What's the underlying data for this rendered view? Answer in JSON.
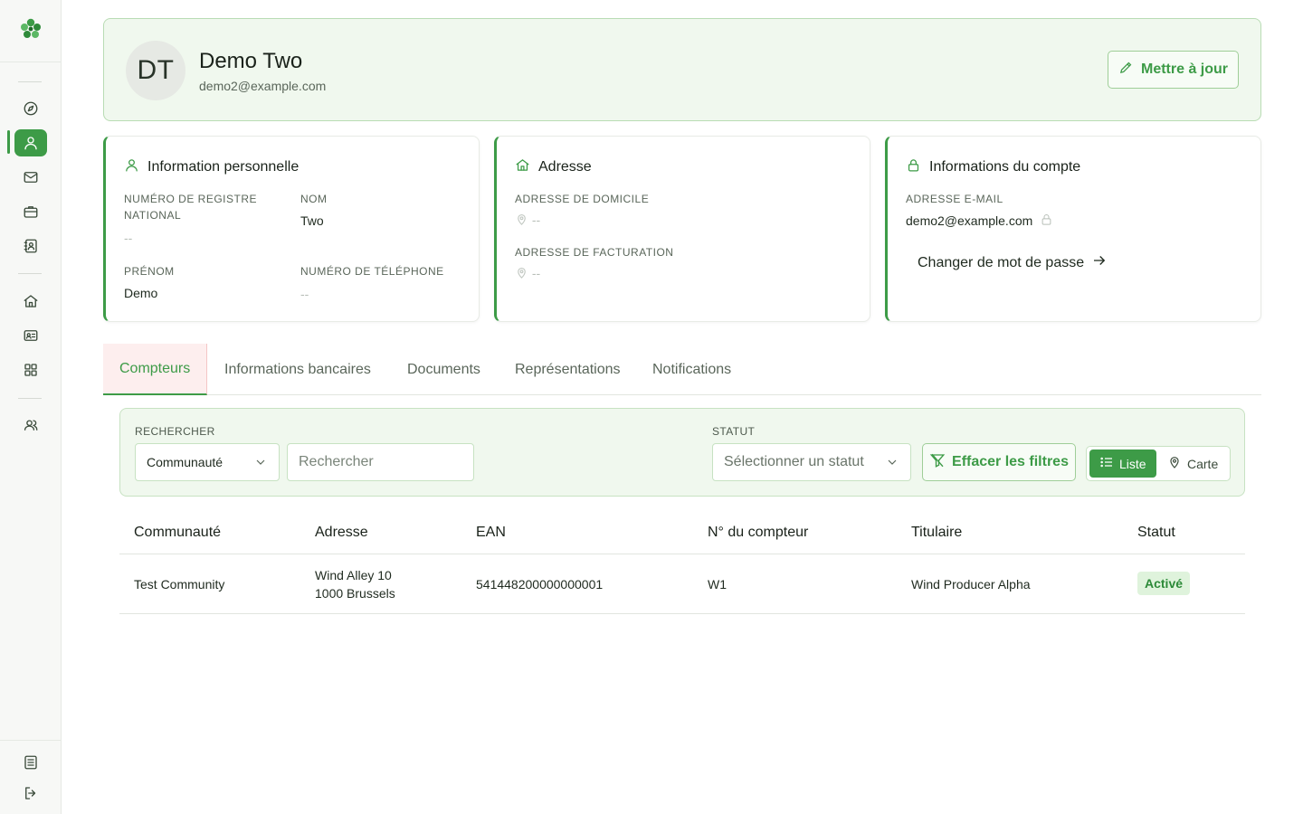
{
  "profile": {
    "initials": "DT",
    "name": "Demo Two",
    "email": "demo2@example.com",
    "update_label": "Mettre à jour"
  },
  "personal": {
    "title": "Information personnelle",
    "registry_label": "Numéro de registre national",
    "registry_value": "--",
    "lastname_label": "Nom",
    "lastname_value": "Two",
    "firstname_label": "Prénom",
    "firstname_value": "Demo",
    "phone_label": "Numéro de téléphone",
    "phone_value": "--"
  },
  "address": {
    "title": "Adresse",
    "home_label": "Adresse de domicile",
    "home_value": "--",
    "billing_label": "Adresse de facturation",
    "billing_value": "--"
  },
  "account": {
    "title": "Informations du compte",
    "email_label": "Adresse e-mail",
    "email_value": "demo2@example.com",
    "password_link": "Changer de mot de passe"
  },
  "tabs": [
    {
      "label": "Compteurs",
      "active": true
    },
    {
      "label": "Informations bancaires"
    },
    {
      "label": "Documents"
    },
    {
      "label": "Représentations"
    },
    {
      "label": "Notifications"
    }
  ],
  "filters": {
    "search_label": "RECHERCHER",
    "search_field_select": "Communauté",
    "search_placeholder": "Rechercher",
    "status_label": "STATUT",
    "status_placeholder": "Sélectionner un statut",
    "clear_label": "Effacer les filtres",
    "view_list": "Liste",
    "view_map": "Carte"
  },
  "table": {
    "headers": [
      "Communauté",
      "Adresse",
      "EAN",
      "N° du compteur",
      "Titulaire",
      "Statut"
    ],
    "rows": [
      {
        "community": "Test Community",
        "address_line1": "Wind Alley 10",
        "address_line2": "1000 Brussels",
        "ean": "541448200000000001",
        "meter": "W1",
        "holder": "Wind Producer Alpha",
        "status": "Activé"
      }
    ]
  },
  "colors": {
    "accent": "#3d9b47",
    "header_bg": "#f0f8ee",
    "badge_bg": "#dff3dc"
  }
}
